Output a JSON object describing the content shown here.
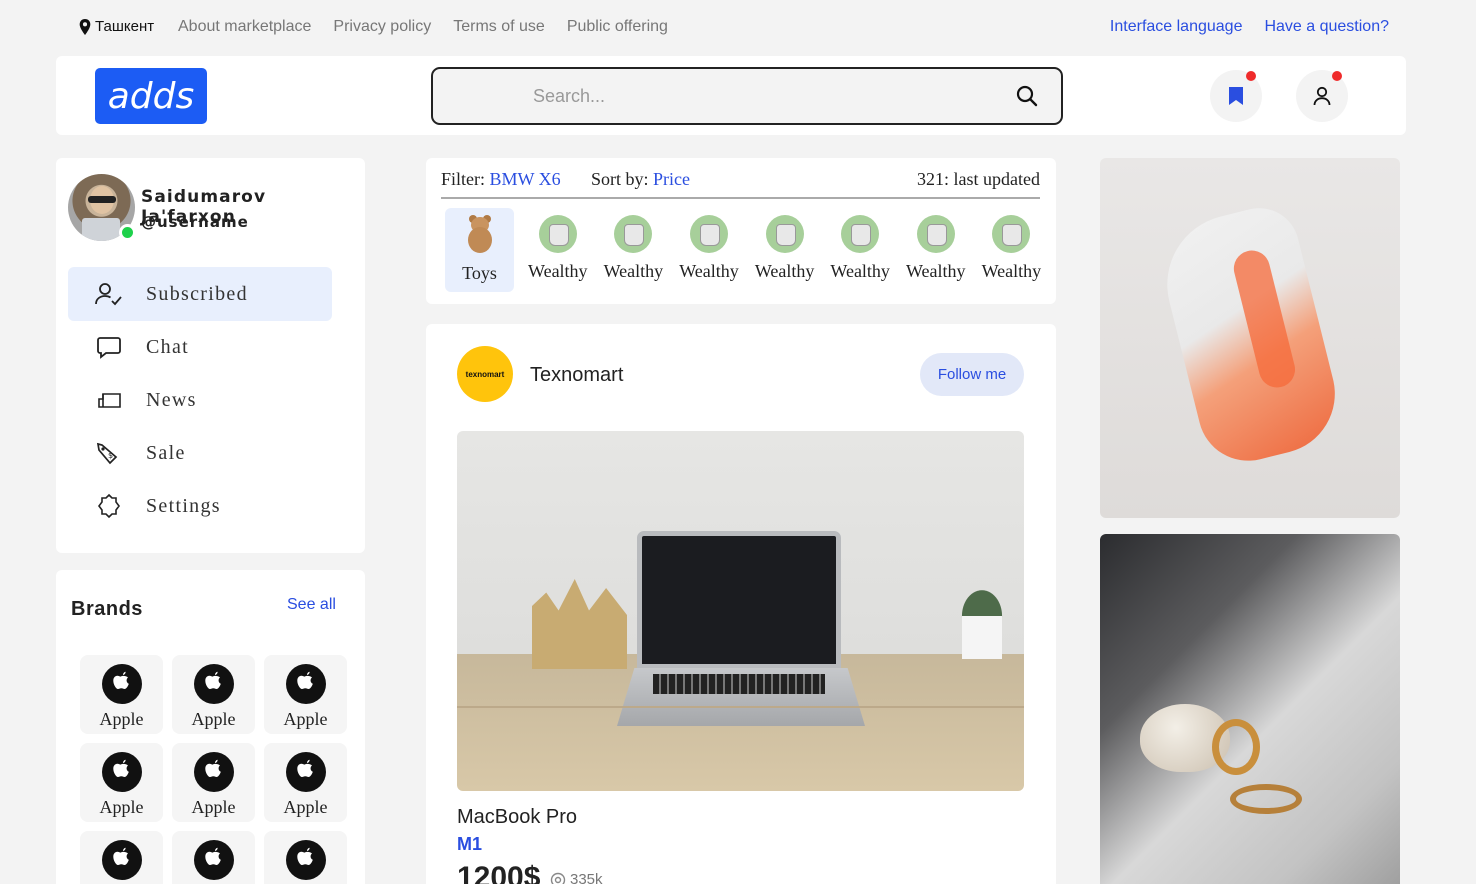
{
  "topbar": {
    "city": "Ташкент",
    "links": [
      "About marketplace",
      "Privacy policy",
      "Terms of use",
      "Public offering"
    ],
    "right_links": [
      "Interface language",
      "Have a question?"
    ]
  },
  "header": {
    "logo": "adds",
    "search_placeholder": "Search..."
  },
  "profile": {
    "name": "Saidumarov Ja'farxon",
    "username": "@username",
    "status_color": "#1ed14b"
  },
  "menu": [
    {
      "label": "Subscribed",
      "icon": "user-check-icon",
      "active": true
    },
    {
      "label": "Chat",
      "icon": "chat-icon",
      "active": false
    },
    {
      "label": "News",
      "icon": "news-icon",
      "active": false
    },
    {
      "label": "Sale",
      "icon": "sale-tag-icon",
      "active": false
    },
    {
      "label": "Settings",
      "icon": "settings-icon",
      "active": false
    }
  ],
  "brands": {
    "title": "Brands",
    "see_all": "See all",
    "items": [
      "Apple",
      "Apple",
      "Apple",
      "Apple",
      "Apple",
      "Apple",
      "Apple",
      "Apple",
      "Apple"
    ]
  },
  "filter": {
    "filter_label": "Filter:",
    "filter_value": "BMW X6",
    "sort_label": "Sort by:",
    "sort_value": "Price",
    "updated": "321: last updated"
  },
  "categories": [
    "Toys",
    "Wealthy",
    "Wealthy",
    "Wealthy",
    "Wealthy",
    "Wealthy",
    "Wealthy",
    "Wealthy"
  ],
  "post": {
    "shop_name": "Texnomart",
    "shop_logo_text": "texnomart",
    "follow_label": "Follow me",
    "product_name": "MacBook Pro",
    "product_model": "M1",
    "price": "1200$",
    "views": "335k"
  },
  "colors": {
    "accent": "#1c5cf4",
    "link": "#2a4ee0",
    "notification_dot": "#ef2b2b",
    "active_bg": "#e8effd"
  }
}
